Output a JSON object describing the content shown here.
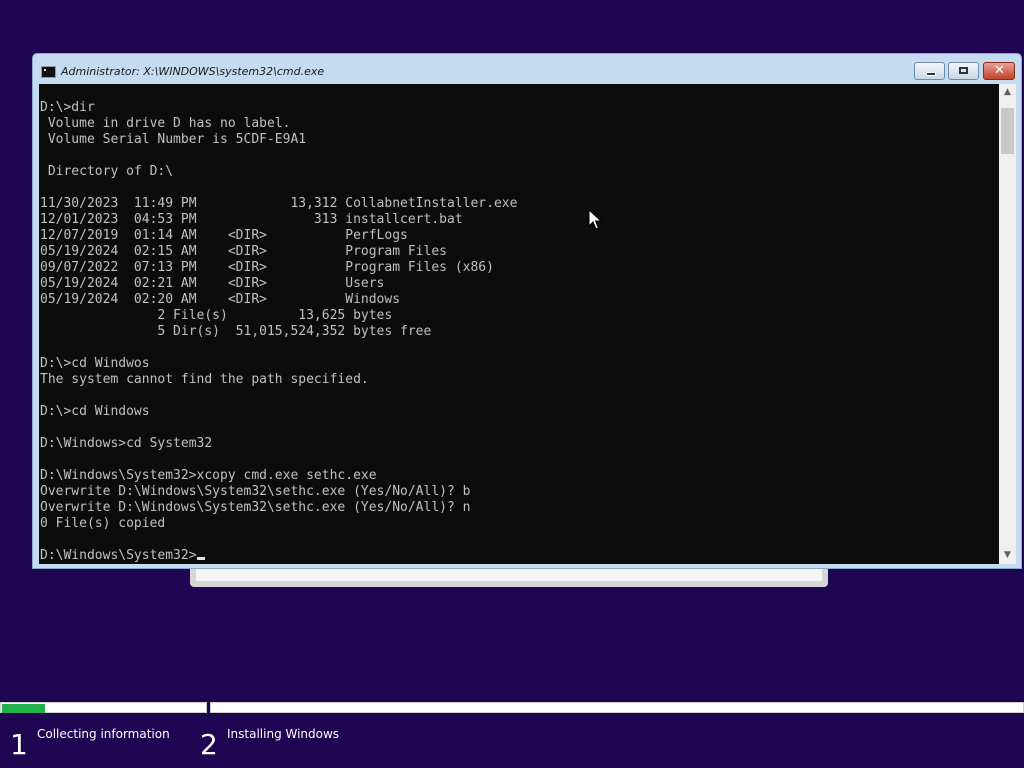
{
  "window": {
    "title": "Administrator: X:\\WINDOWS\\system32\\cmd.exe",
    "close_glyph": "✕"
  },
  "console": {
    "lines": [
      "D:\\>dir",
      " Volume in drive D has no label.",
      " Volume Serial Number is 5CDF-E9A1",
      "",
      " Directory of D:\\",
      "",
      "11/30/2023  11:49 PM            13,312 CollabnetInstaller.exe",
      "12/01/2023  04:53 PM               313 installcert.bat",
      "12/07/2019  01:14 AM    <DIR>          PerfLogs",
      "05/19/2024  02:15 AM    <DIR>          Program Files",
      "09/07/2022  07:13 PM    <DIR>          Program Files (x86)",
      "05/19/2024  02:21 AM    <DIR>          Users",
      "05/19/2024  02:20 AM    <DIR>          Windows",
      "               2 File(s)         13,625 bytes",
      "               5 Dir(s)  51,015,524,352 bytes free",
      "",
      "D:\\>cd Windwos",
      "The system cannot find the path specified.",
      "",
      "D:\\>cd Windows",
      "",
      "D:\\Windows>cd System32",
      "",
      "D:\\Windows\\System32>xcopy cmd.exe sethc.exe",
      "Overwrite D:\\Windows\\System32\\sethc.exe (Yes/No/All)? b",
      "Overwrite D:\\Windows\\System32\\sethc.exe (Yes/No/All)? n",
      "0 File(s) copied",
      ""
    ],
    "prompt": "D:\\Windows\\System32>"
  },
  "scrollbar": {
    "up_arrow": "▲",
    "down_arrow": "▼"
  },
  "setup": {
    "progress_fraction": 0.21,
    "steps": [
      {
        "number": "1",
        "label": "Collecting information"
      },
      {
        "number": "2",
        "label": "Installing Windows"
      }
    ]
  },
  "colors": {
    "desktop_background": "#1f0652",
    "console_background": "#0c0c0c",
    "console_text": "#c0c0c0",
    "progress_fill": "#21b14b"
  }
}
